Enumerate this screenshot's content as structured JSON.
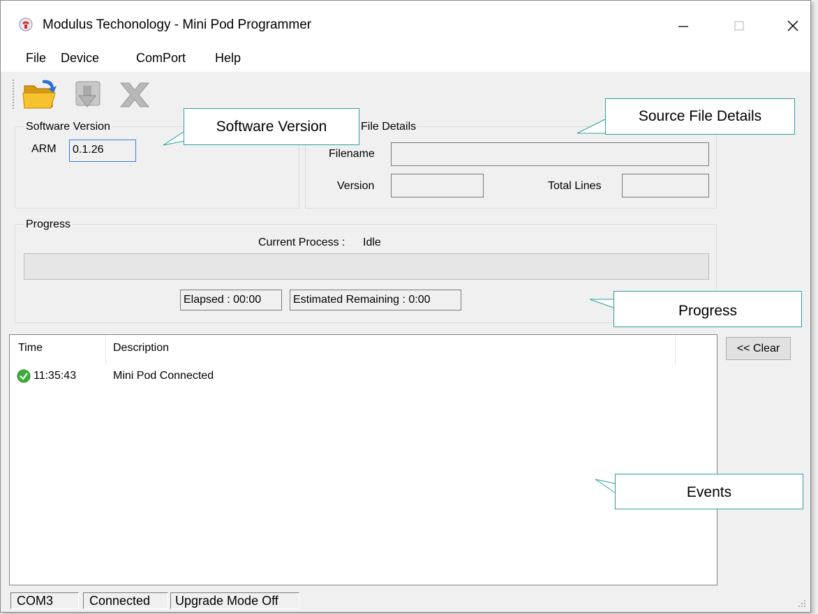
{
  "window": {
    "title": "Modulus Techonology - Mini Pod Programmer",
    "minimize_glyph": "—",
    "maximize_glyph": "☐",
    "close_glyph": "✕"
  },
  "menu": [
    "File",
    "Device",
    "ComPort",
    "Help"
  ],
  "toolbar": {
    "icons": [
      "open-folder-icon",
      "download-icon",
      "cancel-icon"
    ]
  },
  "software_version": {
    "legend": "Software Version",
    "arm_label": "ARM",
    "arm_value": "0.1.26"
  },
  "source_file": {
    "legend": "File Details",
    "filename_label": "Filename",
    "filename_value": "",
    "version_label": "Version",
    "version_value": "",
    "total_lines_label": "Total Lines",
    "total_lines_value": ""
  },
  "progress": {
    "legend": "Progress",
    "current_process_label": "Current Process :",
    "current_process_value": "Idle",
    "elapsed": "Elapsed : 00:00",
    "remaining": "Estimated Remaining : 0:00",
    "fraction": 0
  },
  "events": {
    "columns": [
      "Time",
      "Description"
    ],
    "rows": [
      {
        "time": "11:35:43",
        "description": "Mini Pod Connected",
        "status": "success"
      }
    ],
    "clear_label": "<< Clear"
  },
  "statusbar": {
    "port": "COM3",
    "connection": "Connected",
    "mode": "Upgrade Mode Off"
  },
  "callouts": {
    "software_version": "Software Version",
    "source_file_details": "Source File Details",
    "progress": "Progress",
    "events": "Events"
  },
  "colors": {
    "callout_border": "#2a9fa2",
    "success_green": "#3cae3c",
    "folder_yellow": "#f4b400"
  }
}
